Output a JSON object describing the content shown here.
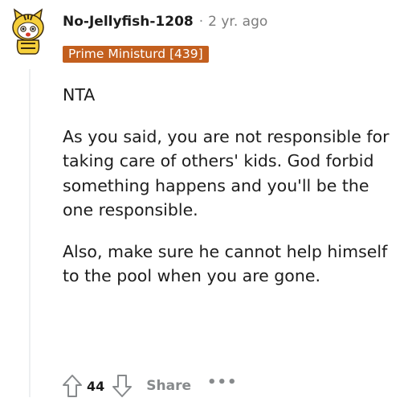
{
  "comment": {
    "author": "No-Jellyfish-1208",
    "separator": "·",
    "time": "2 yr. ago",
    "flair": "Prime Ministurd [439]",
    "paragraphs": [
      "NTA",
      "As you said, you are not responsible for taking care of others' kids. God forbid something happens and you'll be the one responsible.",
      "Also, make sure he cannot help himself to the pool when you are gone."
    ],
    "score": "44",
    "share_label": "Share",
    "more_label": "•••",
    "icons": {
      "avatar": "snoo-avatar-icon",
      "upvote": "upvote-arrow-icon",
      "downvote": "downvote-arrow-icon",
      "more": "more-options-icon"
    },
    "colors": {
      "flair_bg": "#c35f1e",
      "flair_text": "#ffffff",
      "muted": "#878a8c",
      "text": "#1c1c1c"
    }
  }
}
